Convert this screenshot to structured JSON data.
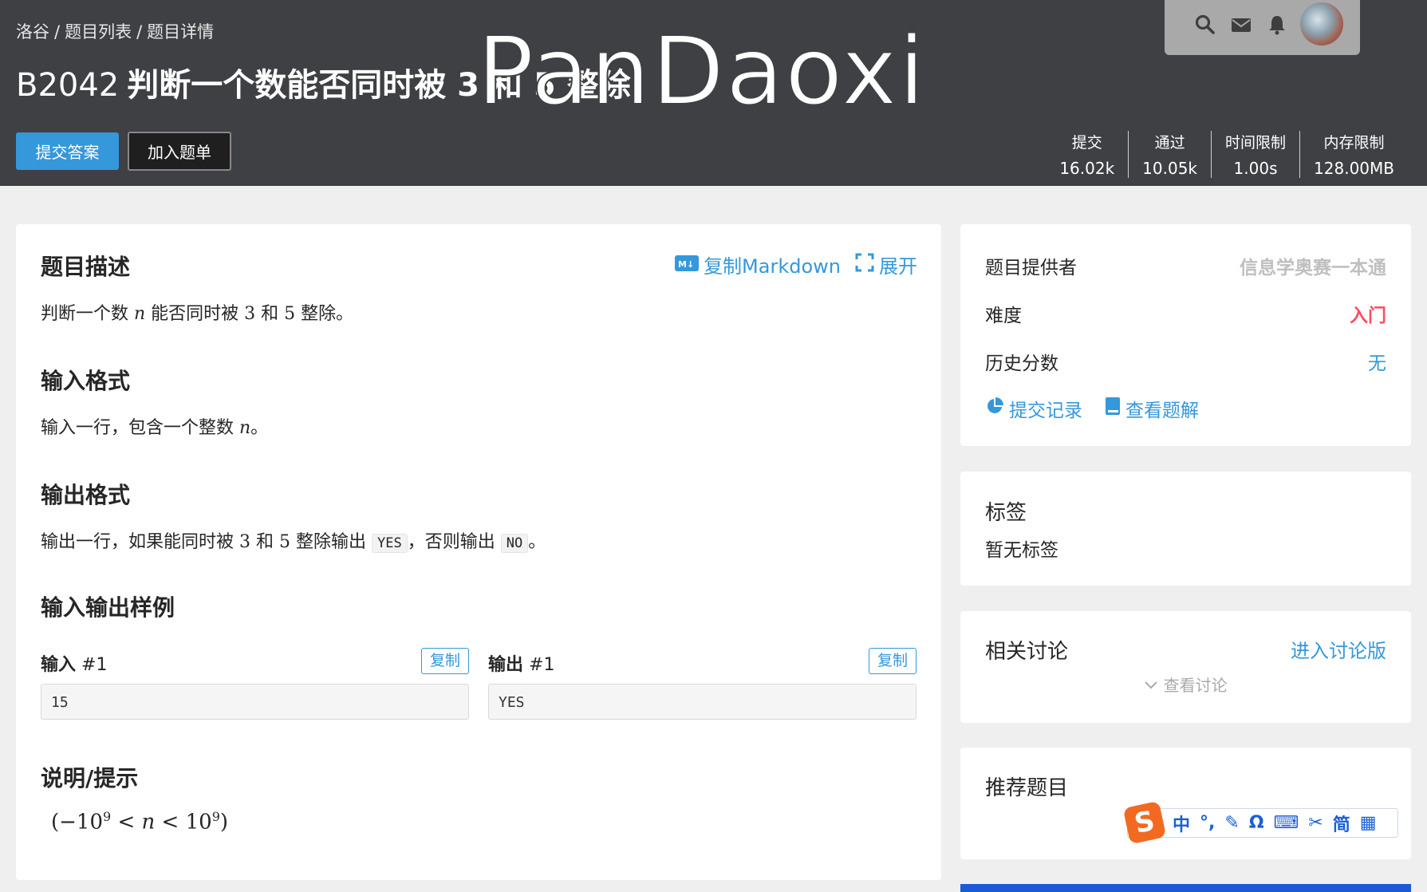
{
  "breadcrumb": {
    "site": "洛谷",
    "list": "题目列表",
    "detail": "题目详情",
    "separator": "/"
  },
  "problem": {
    "id": "B2042",
    "name": "判断一个数能否同时被 3 和 5 整除"
  },
  "watermark": "PanDaoxi",
  "actions": {
    "submit": "提交答案",
    "add_to_list": "加入题单"
  },
  "stats": [
    {
      "label": "提交",
      "value": "16.02k"
    },
    {
      "label": "通过",
      "value": "10.05k"
    },
    {
      "label": "时间限制",
      "value": "1.00s"
    },
    {
      "label": "内存限制",
      "value": "128.00MB"
    }
  ],
  "user_icons": [
    "search-icon",
    "mail-icon",
    "bell-icon",
    "avatar"
  ],
  "content": {
    "copy_markdown": "复制Markdown",
    "expand": "展开",
    "desc_title": "题目描述",
    "desc_a": "判断一个数 ",
    "desc_var": "n",
    "desc_b": " 能否同时被 ",
    "desc_num3": "3",
    "desc_c": " 和 ",
    "desc_num5": "5",
    "desc_d": " 整除。",
    "input_title": "输入格式",
    "input_a": "输入一行，包含一个整数 ",
    "input_var": "n",
    "input_b": "。",
    "output_title": "输出格式",
    "output_a": "输出一行，如果能同时被 ",
    "output_num3": "3",
    "output_b": " 和 ",
    "output_num5": "5",
    "output_c": " 整除输出 ",
    "output_yes": "YES",
    "output_d": "，否则输出 ",
    "output_no": "NO",
    "output_e": "。",
    "samples_title": "输入输出样例",
    "sample_input_label": "输入",
    "sample_output_label": "输出",
    "sample_index": "#1",
    "copy": "复制",
    "sample_input": "15",
    "sample_output": "YES",
    "hint_title": "说明/提示",
    "hint_open": "(−10",
    "hint_exp1": "9",
    "hint_mid": " < ",
    "hint_var": "n",
    "hint_mid2": " < 10",
    "hint_exp2": "9",
    "hint_close": ")"
  },
  "info": {
    "provider_label": "题目提供者",
    "provider": "信息学奥赛一本通",
    "difficulty_label": "难度",
    "difficulty": "入门",
    "history_label": "历史分数",
    "history": "无",
    "records": "提交记录",
    "solutions": "查看题解"
  },
  "tags": {
    "title": "标签",
    "empty": "暂无标签"
  },
  "discuss": {
    "title": "相关讨论",
    "enter": "进入讨论版",
    "view": "查看讨论"
  },
  "recommend": {
    "title": "推荐题目"
  },
  "ime": {
    "logo": "S",
    "items": [
      "中",
      "°,",
      "✎",
      "Ω",
      "⌨",
      "✂",
      "简",
      "▦"
    ]
  },
  "colors": {
    "accent": "#3498db",
    "topbar": "#3e4043",
    "difficulty": "#fe4c61",
    "ime_bar": "#1d58d8"
  }
}
